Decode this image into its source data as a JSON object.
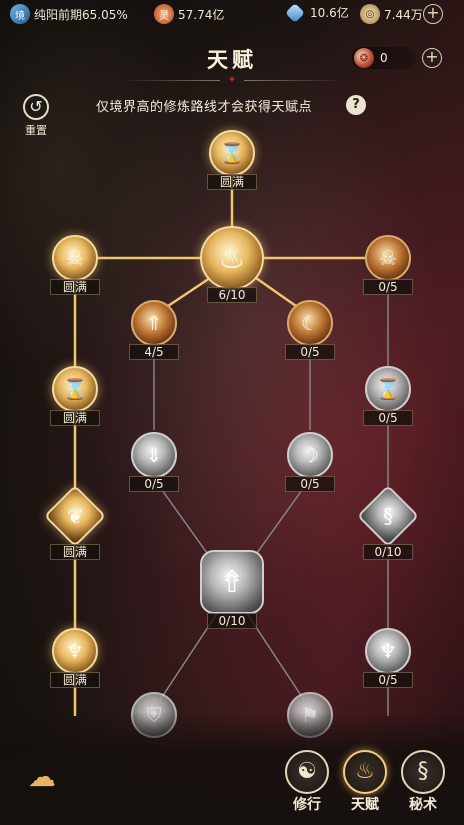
{
  "resources": {
    "realm": {
      "icon": "realm-badge-icon",
      "label": "纯阳前期65.05%"
    },
    "spirit": {
      "icon": "spirit-coin-icon",
      "label": "57.74亿"
    },
    "crystal": {
      "icon": "blue-crystal-icon",
      "label": "10.6亿"
    },
    "coin": {
      "icon": "gold-coin-icon",
      "label": "7.44万"
    },
    "add": "+"
  },
  "title": "天赋",
  "talent_points": {
    "icon": "talent-point-icon",
    "value": "0",
    "add": "+"
  },
  "reset": {
    "icon": "reset-icon",
    "label": "重置"
  },
  "hint": "仅境界高的修炼路线才会获得天赋点",
  "help": "?",
  "tree": {
    "top": {
      "icon": "hourglass-icon",
      "label": "圆满"
    },
    "center": {
      "icon": "flame-icon",
      "label": "6/10"
    },
    "left1": {
      "icon": "demon-mask-icon",
      "label": "圆满"
    },
    "right1": {
      "icon": "demon-mask-icon",
      "label": "0/5"
    },
    "lmid1": {
      "icon": "sword-up-icon",
      "label": "4/5"
    },
    "rmid1": {
      "icon": "moon-up-icon",
      "label": "0/5"
    },
    "left2": {
      "icon": "hourglass-icon",
      "label": "圆满"
    },
    "right2": {
      "icon": "hourglass-icon",
      "label": "0/5"
    },
    "lmid2": {
      "icon": "sword-down-icon",
      "label": "0/5"
    },
    "rmid2": {
      "icon": "moon-down-icon",
      "label": "0/5"
    },
    "left3": {
      "icon": "phoenix-icon",
      "label": "圆满"
    },
    "right3": {
      "icon": "dragon-icon",
      "label": "0/10"
    },
    "bottom_center": {
      "icon": "deity-arrow-icon",
      "label": "0/10"
    },
    "left4": {
      "icon": "fire-spirit-icon",
      "label": "圆满"
    },
    "right4": {
      "icon": "fire-spirit-icon",
      "label": "0/5"
    }
  },
  "nav": {
    "cloud": "cloud-emblem-icon",
    "tabs": [
      {
        "icon": "cultivate-icon",
        "label": "修行",
        "active": false
      },
      {
        "icon": "talent-icon",
        "label": "天赋",
        "active": true
      },
      {
        "icon": "secret-art-icon",
        "label": "秘术",
        "active": false
      }
    ]
  }
}
